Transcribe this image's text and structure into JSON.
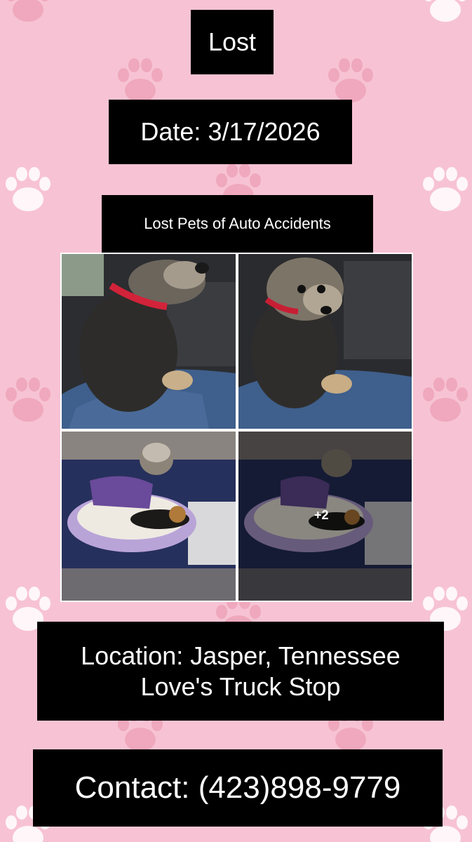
{
  "flyer": {
    "heading": "Lost",
    "date": "Date: 3/17/2026",
    "group_name": "Lost Pets of Auto Accidents",
    "location_line1": "Location: Jasper, Tennessee",
    "location_line2": "Love's Truck Stop",
    "contact": "Contact: (423)898-9779"
  },
  "photos": {
    "more_count": "+2"
  },
  "colors": {
    "background": "#f7c3d4",
    "paw": "#e9a3b8",
    "label_bg": "#000000",
    "label_text": "#ffffff"
  },
  "icons": [
    "paw-print-icon"
  ]
}
